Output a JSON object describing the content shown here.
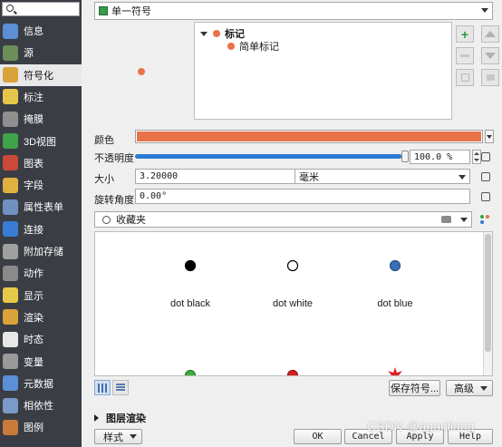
{
  "sidebar": {
    "items": [
      {
        "label": "信息",
        "icon": "info-icon",
        "color": "#5b8fd6"
      },
      {
        "label": "源",
        "icon": "source-icon",
        "color": "#6b8e5a"
      },
      {
        "label": "符号化",
        "icon": "paintbrush-icon",
        "color": "#d9a23a",
        "active": true
      },
      {
        "label": "标注",
        "icon": "label-abc-icon",
        "color": "#e6c64a"
      },
      {
        "label": "掩膜",
        "icon": "mask-abc-icon",
        "color": "#8f8f8f"
      },
      {
        "label": "3D视图",
        "icon": "cube-3d-icon",
        "color": "#3fa34a"
      },
      {
        "label": "图表",
        "icon": "diagram-icon",
        "color": "#c94a3a"
      },
      {
        "label": "字段",
        "icon": "fields-icon",
        "color": "#e0b040"
      },
      {
        "label": "属性表单",
        "icon": "attribute-form-icon",
        "color": "#7090c0"
      },
      {
        "label": "连接",
        "icon": "join-icon",
        "color": "#3a7bd5"
      },
      {
        "label": "附加存储",
        "icon": "auxiliary-storage-icon",
        "color": "#a0a0a0"
      },
      {
        "label": "动作",
        "icon": "action-gear-icon",
        "color": "#8a8a8a"
      },
      {
        "label": "显示",
        "icon": "display-speech-icon",
        "color": "#e8c84a"
      },
      {
        "label": "渲染",
        "icon": "rendering-brush-icon",
        "color": "#d9a23a"
      },
      {
        "label": "时态",
        "icon": "clock-icon",
        "color": "#e8e8e8"
      },
      {
        "label": "变量",
        "icon": "variable-icon",
        "color": "#9a9a9a"
      },
      {
        "label": "元数据",
        "icon": "metadata-icon",
        "color": "#5b8fd6"
      },
      {
        "label": "相依性",
        "icon": "dependencies-icon",
        "color": "#7a9ac8"
      },
      {
        "label": "图例",
        "icon": "legend-icon",
        "color": "#c97a3a"
      }
    ]
  },
  "renderer": {
    "value": "单一符号"
  },
  "tree": {
    "root": "标记",
    "child": "简单标记"
  },
  "color_row": {
    "label": "颜色",
    "color": "#e8734a"
  },
  "opacity": {
    "label": "不透明度",
    "value": "100.0 %",
    "fraction": 1.0
  },
  "size": {
    "label": "大小",
    "value": "3.20000",
    "unit": "毫米"
  },
  "rotation": {
    "label": "旋转角度",
    "value": "0.00°"
  },
  "library": {
    "search_value": "收藏夹"
  },
  "symbols": [
    {
      "name": "dot  black",
      "fill": "#000000",
      "stroke": "#000000"
    },
    {
      "name": "dot  white",
      "fill": "#ffffff",
      "stroke": "#000000"
    },
    {
      "name": "dot blue",
      "fill": "#3a6fb8",
      "stroke": "#2a4f88"
    },
    {
      "fill": "#3cae3c",
      "stroke": "#2a7a2a"
    },
    {
      "fill": "#d42020",
      "stroke": "#901010"
    },
    {
      "fill": "#e02020",
      "stroke": "#e02020"
    }
  ],
  "buttons": {
    "save_symbol": "保存符号...",
    "advanced": "高级",
    "layer_rendering": "图层渲染",
    "style": "样式",
    "ok": "OK",
    "cancel": "Cancel",
    "apply": "Apply",
    "help": "Help"
  },
  "watermark": "CSDN @aganliang"
}
